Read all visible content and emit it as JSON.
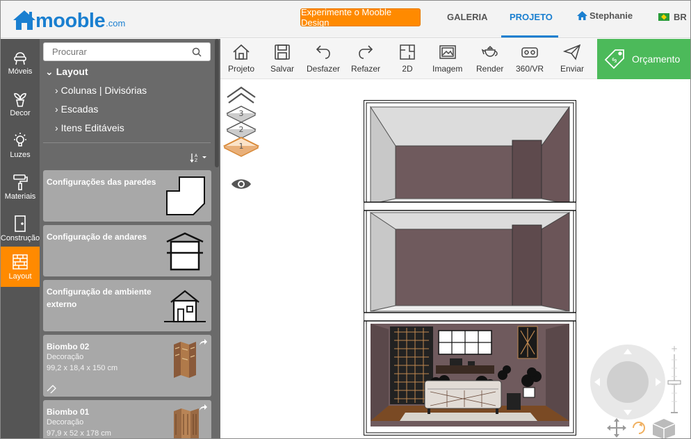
{
  "header": {
    "logo_word": "mooble",
    "logo_suffix": ".com",
    "try_button": "Experimente o Mooble Design",
    "nav_galeria": "GALERIA",
    "nav_projeto": "PROJETO",
    "user_name": "Stephanie",
    "lang": "BR"
  },
  "rail": {
    "items": [
      {
        "label": "Móveis",
        "icon": "chair-icon"
      },
      {
        "label": "Decor",
        "icon": "plant-icon"
      },
      {
        "label": "Luzes",
        "icon": "bulb-icon"
      },
      {
        "label": "Materiais",
        "icon": "paint-roller-icon"
      },
      {
        "label": "Construção",
        "icon": "door-icon"
      },
      {
        "label": "Layout",
        "icon": "wall-icon",
        "active": true
      }
    ]
  },
  "panel": {
    "search_placeholder": "Procurar",
    "tree_root": "Layout",
    "tree_children": [
      "Colunas | Divisórias",
      "Escadas",
      "Itens Editáveis"
    ],
    "sort_label": "A Z",
    "cards": [
      {
        "title": "Configurações das paredes",
        "icon": "wall-shape-icon"
      },
      {
        "title": "Configuração de andares",
        "icon": "floors-icon"
      },
      {
        "title": "Configuração de ambiente externo",
        "icon": "house-icon"
      },
      {
        "title": "Biombo 02",
        "category": "Decoração",
        "dims": "99,2 x 18,4 x 150 cm"
      },
      {
        "title": "Biombo 01",
        "category": "Decoração",
        "dims": "97,9 x 52 x 178 cm"
      }
    ]
  },
  "toolbar": {
    "projeto": "Projeto",
    "salvar": "Salvar",
    "desfazer": "Desfazer",
    "refazer": "Refazer",
    "2d": "2D",
    "imagem": "Imagem",
    "render": "Render",
    "vr": "360/VR",
    "enviar": "Enviar",
    "orcamento": "Orçamento"
  },
  "canvas": {
    "floors": [
      "3",
      "2",
      "1"
    ],
    "active_floor": "1"
  },
  "colors": {
    "brand_blue": "#1a7fd0",
    "accent_orange": "#ff8a00",
    "budget_green": "#4cba5a",
    "rail_bg": "#555555",
    "panel_bg": "#6a6a6a",
    "wall_mauve": "#6b5558"
  }
}
